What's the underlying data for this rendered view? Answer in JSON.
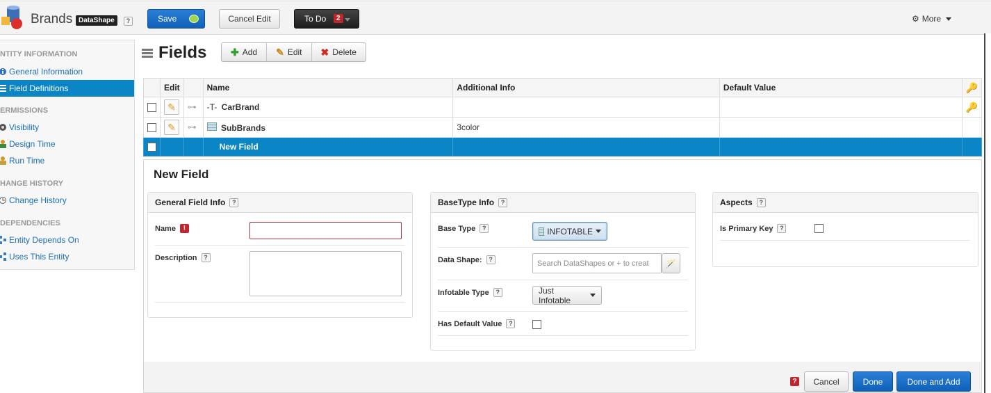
{
  "header": {
    "entity_name": "Brands",
    "entity_type": "DataShape",
    "help": "?",
    "save_label": "Save",
    "cancel_edit_label": "Cancel Edit",
    "todo_label": "To Do",
    "todo_count": "2",
    "more_label": "More"
  },
  "sidebar": {
    "sections": [
      {
        "title": "NTITY INFORMATION",
        "items": [
          "General Information",
          "Field Definitions"
        ]
      },
      {
        "title": "ERMISSIONS",
        "items": [
          "Visibility",
          "Design Time",
          "Run Time"
        ]
      },
      {
        "title": "HANGE HISTORY",
        "items": [
          "Change History"
        ]
      },
      {
        "title": "DEPENDENCIES",
        "items": [
          "Entity Depends On",
          "Uses This Entity"
        ]
      }
    ],
    "active_item": "Field Definitions"
  },
  "fields": {
    "title": "Fields",
    "add_label": "Add",
    "edit_label": "Edit",
    "delete_label": "Delete",
    "columns": [
      "Edit",
      "Name",
      "Additional Info",
      "Default Value"
    ],
    "rows": [
      {
        "name": "CarBrand",
        "additional_info": "",
        "default_value": "",
        "primary_key": true
      },
      {
        "name": "SubBrands",
        "additional_info": "3color",
        "default_value": "",
        "primary_key": false
      },
      {
        "name": "New Field",
        "additional_info": "",
        "default_value": "",
        "primary_key": false,
        "selected": true
      }
    ]
  },
  "new_field": {
    "title": "New Field",
    "general": {
      "title": "General Field Info",
      "name_label": "Name",
      "name_value": "",
      "description_label": "Description",
      "description_value": ""
    },
    "basetype": {
      "title": "BaseType Info",
      "base_type_label": "Base Type",
      "base_type_value": "INFOTABLE",
      "data_shape_label": "Data Shape:",
      "data_shape_placeholder": "Search DataShapes or + to creat",
      "infotable_type_label": "Infotable Type",
      "infotable_type_value": "Just Infotable",
      "has_default_label": "Has Default Value"
    },
    "aspects": {
      "title": "Aspects",
      "primary_key_label": "Is Primary Key"
    }
  },
  "footer": {
    "cancel_label": "Cancel",
    "done_label": "Done",
    "done_add_label": "Done and Add"
  },
  "colors": {
    "accent": "#0a86c7",
    "primary_button": "#1a6fc8",
    "error": "#c0272d"
  }
}
